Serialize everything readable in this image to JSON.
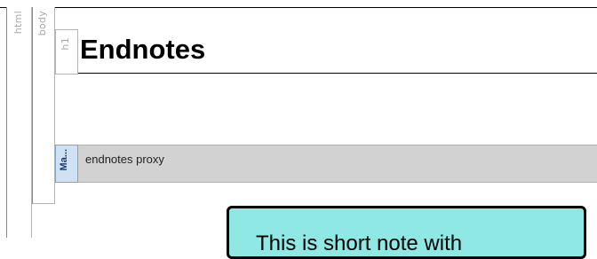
{
  "tree_tags": {
    "html": "html",
    "body": "body",
    "h1": "h1",
    "marker": "Ma..."
  },
  "heading": "Endnotes",
  "proxy": {
    "label": "endnotes proxy"
  },
  "note": {
    "text": "This is short note with"
  }
}
